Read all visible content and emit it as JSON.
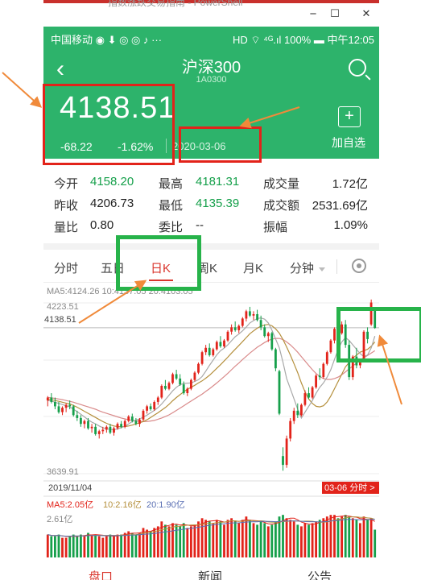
{
  "window": {
    "title": "指数涨跌交易指南 - PowerShell",
    "minimize": "−",
    "maximize": "☐",
    "close": "✕"
  },
  "status_bar": {
    "left": "中国移动 ◉ ⬇ ◎ ◎ ♪ ···",
    "right": "HD ⌔ ⁴ᴳ.ıl 100% ▬ 中午12:05"
  },
  "header": {
    "title": "沪深300",
    "code": "1A0300",
    "back_icon": "back-arrow-icon",
    "search_icon": "search-icon"
  },
  "quote": {
    "price": "4138.51",
    "change": "-68.22",
    "change_pct": "-1.62%",
    "date": "2020-03-06",
    "add_icon": "+",
    "add_label": "加自选"
  },
  "stats": [
    {
      "label": "今开",
      "value": "4158.20",
      "tone": "up"
    },
    {
      "label": "最高",
      "value": "4181.31",
      "tone": "up"
    },
    {
      "label": "成交量",
      "value": "1.72亿",
      "tone": "blk"
    },
    {
      "label": "昨收",
      "value": "4206.73",
      "tone": "blk"
    },
    {
      "label": "最低",
      "value": "4135.39",
      "tone": "up"
    },
    {
      "label": "成交额",
      "value": "2531.69亿",
      "tone": "blk"
    },
    {
      "label": "量比",
      "value": "0.80",
      "tone": "blk"
    },
    {
      "label": "委比",
      "value": "--",
      "tone": "blk"
    },
    {
      "label": "振幅",
      "value": "1.09%",
      "tone": "blk"
    }
  ],
  "tabs": [
    {
      "label": "分时",
      "active": false
    },
    {
      "label": "五日",
      "active": false
    },
    {
      "label": "日K",
      "active": true
    },
    {
      "label": "周K",
      "active": false
    },
    {
      "label": "月K",
      "active": false
    },
    {
      "label": "分钟",
      "active": false
    }
  ],
  "chart": {
    "ma_legend": "MA5:4124.26   10:4137.05   20:4103.05",
    "price_high": "4223.51",
    "price_current": "4138.51",
    "price_low": "3639.91",
    "start_date": "2019/11/04",
    "end_badge": "03-06 分时 >",
    "vol_legend": [
      "MA5:2.05亿",
      "10:2.16亿",
      "20:1.90亿"
    ],
    "vol_max": "2.61亿",
    "colors": {
      "up": "#e2231a",
      "down": "#16a04b",
      "ma5": "#a8a8a8",
      "ma10": "#b5903d",
      "ma20": "#d98a8a"
    }
  },
  "chart_data": {
    "type": "candlestick",
    "ylim": [
      3639.91,
      4223.51
    ],
    "x_start": "2019/11/04",
    "x_end": "03-06",
    "candles": [
      [
        3890,
        3905,
        3870,
        3900
      ],
      [
        3900,
        3915,
        3880,
        3885
      ],
      [
        3885,
        3900,
        3860,
        3870
      ],
      [
        3870,
        3885,
        3845,
        3850
      ],
      [
        3850,
        3870,
        3840,
        3865
      ],
      [
        3865,
        3880,
        3850,
        3875
      ],
      [
        3875,
        3890,
        3860,
        3870
      ],
      [
        3870,
        3875,
        3835,
        3840
      ],
      [
        3840,
        3855,
        3820,
        3830
      ],
      [
        3830,
        3840,
        3800,
        3810
      ],
      [
        3810,
        3825,
        3795,
        3820
      ],
      [
        3820,
        3830,
        3790,
        3795
      ],
      [
        3795,
        3810,
        3780,
        3800
      ],
      [
        3800,
        3810,
        3770,
        3775
      ],
      [
        3775,
        3790,
        3760,
        3785
      ],
      [
        3785,
        3800,
        3775,
        3790
      ],
      [
        3790,
        3805,
        3780,
        3800
      ],
      [
        3800,
        3810,
        3775,
        3780
      ],
      [
        3780,
        3800,
        3770,
        3795
      ],
      [
        3795,
        3815,
        3790,
        3810
      ],
      [
        3810,
        3820,
        3795,
        3800
      ],
      [
        3800,
        3825,
        3795,
        3820
      ],
      [
        3820,
        3840,
        3815,
        3835
      ],
      [
        3835,
        3845,
        3815,
        3820
      ],
      [
        3820,
        3830,
        3805,
        3810
      ],
      [
        3810,
        3830,
        3800,
        3825
      ],
      [
        3825,
        3860,
        3820,
        3855
      ],
      [
        3855,
        3875,
        3845,
        3870
      ],
      [
        3870,
        3880,
        3855,
        3860
      ],
      [
        3860,
        3890,
        3855,
        3885
      ],
      [
        3885,
        3905,
        3875,
        3900
      ],
      [
        3900,
        3945,
        3895,
        3940
      ],
      [
        3940,
        3960,
        3925,
        3930
      ],
      [
        3930,
        3955,
        3925,
        3950
      ],
      [
        3950,
        3985,
        3945,
        3980
      ],
      [
        3980,
        3995,
        3960,
        3965
      ],
      [
        3965,
        3980,
        3940,
        3945
      ],
      [
        3945,
        3955,
        3910,
        3915
      ],
      [
        3915,
        3935,
        3905,
        3930
      ],
      [
        3930,
        3965,
        3925,
        3960
      ],
      [
        3960,
        3990,
        3955,
        3985
      ],
      [
        3985,
        4020,
        3980,
        4015
      ],
      [
        4015,
        4060,
        4010,
        4055
      ],
      [
        4055,
        4080,
        4045,
        4070
      ],
      [
        4070,
        4085,
        4040,
        4045
      ],
      [
        4045,
        4070,
        4040,
        4065
      ],
      [
        4065,
        4095,
        4060,
        4090
      ],
      [
        4090,
        4110,
        4070,
        4075
      ],
      [
        4075,
        4100,
        4070,
        4095
      ],
      [
        4095,
        4130,
        4090,
        4125
      ],
      [
        4125,
        4150,
        4115,
        4140
      ],
      [
        4140,
        4160,
        4125,
        4130
      ],
      [
        4130,
        4150,
        4120,
        4145
      ],
      [
        4145,
        4175,
        4140,
        4170
      ],
      [
        4170,
        4200,
        4160,
        4195
      ],
      [
        4195,
        4210,
        4175,
        4180
      ],
      [
        4180,
        4195,
        4165,
        4185
      ],
      [
        4185,
        4200,
        4160,
        4165
      ],
      [
        4165,
        4180,
        4130,
        4140
      ],
      [
        4140,
        4150,
        4105,
        4110
      ],
      [
        4110,
        4125,
        4090,
        4120
      ],
      [
        4120,
        4125,
        4060,
        4065
      ],
      [
        4065,
        4070,
        3990,
        4000
      ],
      [
        3990,
        3995,
        3840,
        3845
      ],
      [
        3700,
        3730,
        3650,
        3670
      ],
      [
        3670,
        3770,
        3660,
        3760
      ],
      [
        3760,
        3830,
        3750,
        3820
      ],
      [
        3820,
        3865,
        3810,
        3855
      ],
      [
        3855,
        3880,
        3830,
        3840
      ],
      [
        3840,
        3880,
        3835,
        3875
      ],
      [
        3875,
        3925,
        3870,
        3915
      ],
      [
        3915,
        3935,
        3895,
        3900
      ],
      [
        3900,
        3940,
        3895,
        3935
      ],
      [
        3935,
        3980,
        3930,
        3975
      ],
      [
        3975,
        4000,
        3960,
        3970
      ],
      [
        3970,
        4020,
        3965,
        4015
      ],
      [
        4015,
        4060,
        4010,
        4055
      ],
      [
        4055,
        4100,
        4050,
        4095
      ],
      [
        4095,
        4140,
        4085,
        4135
      ],
      [
        4135,
        4150,
        4110,
        4120
      ],
      [
        4120,
        4160,
        4115,
        4150
      ],
      [
        4150,
        4165,
        4070,
        4080
      ],
      [
        4080,
        4095,
        3960,
        3970
      ],
      [
        3970,
        4045,
        3960,
        4040
      ],
      [
        4040,
        4070,
        4000,
        4010
      ],
      [
        4010,
        4030,
        4000,
        4025
      ],
      [
        4025,
        4130,
        4020,
        4125
      ],
      [
        4125,
        4140,
        4085,
        4100
      ],
      [
        4150,
        4235,
        4145,
        4225
      ],
      [
        4206,
        4181,
        4135,
        4138
      ]
    ],
    "ma5": [
      3890,
      3888,
      3884,
      3880,
      3876,
      3872,
      3868,
      3860,
      3852,
      3843,
      3834,
      3824,
      3816,
      3810,
      3803,
      3797,
      3793,
      3792,
      3790,
      3793,
      3797,
      3802,
      3810,
      3818,
      3823,
      3827,
      3833,
      3840,
      3848,
      3856,
      3866,
      3878,
      3893,
      3908,
      3923,
      3935,
      3944,
      3948,
      3949,
      3950,
      3955,
      3961,
      3972,
      3990,
      4010,
      4028,
      4046,
      4060,
      4069,
      4080,
      4094,
      4108,
      4117,
      4128,
      4141,
      4155,
      4163,
      4170,
      4172,
      4168,
      4155,
      4130,
      4100,
      4070,
      4020,
      3965,
      3930,
      3895,
      3860,
      3830,
      3850,
      3870,
      3890,
      3915,
      3935,
      3950,
      3970,
      3995,
      4030,
      4065,
      4090,
      4105,
      4095,
      4080,
      4065,
      4050,
      4040,
      4045,
      4070,
      4110
    ],
    "ma10": [
      3895,
      3893,
      3890,
      3887,
      3884,
      3881,
      3878,
      3873,
      3867,
      3860,
      3853,
      3846,
      3839,
      3832,
      3825,
      3818,
      3812,
      3807,
      3803,
      3801,
      3800,
      3801,
      3803,
      3806,
      3810,
      3814,
      3818,
      3824,
      3832,
      3840,
      3848,
      3857,
      3866,
      3877,
      3889,
      3900,
      3910,
      3920,
      3928,
      3935,
      3942,
      3950,
      3957,
      3966,
      3976,
      3988,
      4000,
      4012,
      4025,
      4038,
      4052,
      4065,
      4078,
      4091,
      4105,
      4118,
      4128,
      4137,
      4144,
      4148,
      4150,
      4145,
      4135,
      4120,
      4098,
      4073,
      4045,
      4015,
      3985,
      3950,
      3920,
      3895,
      3880,
      3870,
      3868,
      3872,
      3885,
      3905,
      3930,
      3955,
      3980,
      4005,
      4020,
      4035,
      4045,
      4055,
      4060,
      4065,
      4075,
      4090
    ],
    "ma20": [
      3900,
      3899,
      3897,
      3895,
      3893,
      3890,
      3887,
      3884,
      3880,
      3876,
      3872,
      3868,
      3864,
      3860,
      3855,
      3850,
      3846,
      3842,
      3838,
      3834,
      3830,
      3827,
      3824,
      3822,
      3820,
      3819,
      3818,
      3818,
      3820,
      3822,
      3826,
      3830,
      3835,
      3841,
      3848,
      3856,
      3864,
      3872,
      3880,
      3888,
      3896,
      3904,
      3912,
      3921,
      3930,
      3940,
      3950,
      3961,
      3972,
      3983,
      3995,
      4007,
      4018,
      4030,
      4041,
      4052,
      4062,
      4072,
      4080,
      4088,
      4095,
      4100,
      4102,
      4102,
      4098,
      4090,
      4080,
      4068,
      4055,
      4040,
      4025,
      4010,
      3995,
      3982,
      3972,
      3965,
      3962,
      3962,
      3965,
      3970,
      3978,
      3988,
      3998,
      4008,
      4018,
      4028,
      4036,
      4044,
      4052,
      4060
    ],
    "volumes": [
      1.4,
      1.3,
      1.3,
      1.4,
      1.2,
      1.2,
      1.3,
      1.4,
      1.3,
      1.4,
      1.3,
      1.5,
      1.4,
      1.4,
      1.3,
      1.2,
      1.3,
      1.4,
      1.3,
      1.4,
      1.4,
      1.5,
      1.6,
      1.5,
      1.4,
      1.5,
      1.8,
      1.7,
      1.6,
      1.8,
      1.9,
      2.2,
      2.0,
      1.9,
      2.1,
      2.0,
      1.9,
      2.1,
      1.8,
      1.9,
      2.0,
      2.2,
      2.4,
      2.3,
      2.2,
      2.1,
      2.3,
      2.2,
      2.0,
      2.3,
      2.4,
      2.2,
      2.1,
      2.3,
      2.5,
      2.3,
      2.1,
      2.0,
      2.2,
      2.1,
      1.9,
      2.0,
      2.2,
      2.5,
      2.6,
      2.4,
      2.3,
      2.2,
      2.0,
      1.9,
      2.1,
      2.0,
      2.1,
      2.2,
      2.3,
      2.4,
      2.5,
      2.6,
      2.6,
      2.4,
      2.5,
      2.6,
      2.5,
      2.4,
      2.3,
      2.1,
      2.5,
      2.3,
      2.4,
      1.7
    ]
  },
  "bottom_tabs": [
    {
      "label": "盘口",
      "active": true
    },
    {
      "label": "新闻",
      "active": false
    },
    {
      "label": "公告",
      "active": false
    }
  ]
}
